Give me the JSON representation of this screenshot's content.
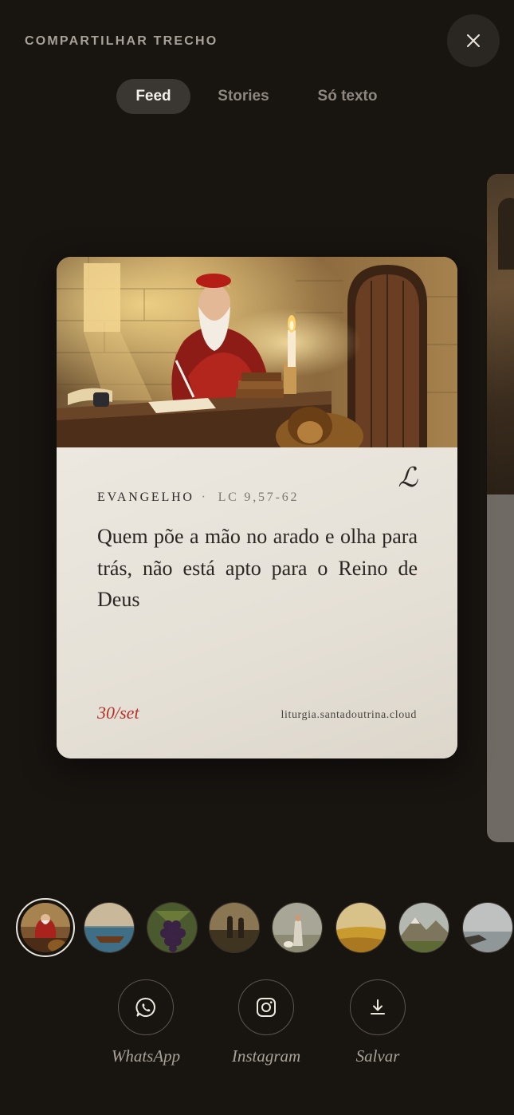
{
  "header": {
    "title": "COMPARTILHAR TRECHO",
    "close_icon": "close-icon"
  },
  "tabs": [
    {
      "label": "Feed",
      "active": true
    },
    {
      "label": "Stories",
      "active": false
    },
    {
      "label": "Só texto",
      "active": false
    }
  ],
  "card": {
    "brand": "ℒ",
    "book": "EVANGELHO",
    "separator": "·",
    "citation": "LC 9,57-62",
    "quote": "Quem põe a mão no arado e olha para trás, não está apto para o Reino de Deus",
    "date": "30/set",
    "site": "liturgia.santadoutrina.cloud"
  },
  "backgrounds": [
    {
      "name": "saint-writing",
      "selected": true
    },
    {
      "name": "boat-lake",
      "selected": false
    },
    {
      "name": "grapes",
      "selected": false
    },
    {
      "name": "field-prayer",
      "selected": false
    },
    {
      "name": "shepherd",
      "selected": false
    },
    {
      "name": "golden-field",
      "selected": false
    },
    {
      "name": "mountains",
      "selected": false
    },
    {
      "name": "sea-shore",
      "selected": false
    }
  ],
  "actions": [
    {
      "label": "WhatsApp",
      "icon": "whatsapp-icon"
    },
    {
      "label": "Instagram",
      "icon": "instagram-icon"
    },
    {
      "label": "Salvar",
      "icon": "download-icon"
    }
  ],
  "colors": {
    "background": "#181410",
    "card": "#e8e3da",
    "accent_red": "#b0322a"
  }
}
